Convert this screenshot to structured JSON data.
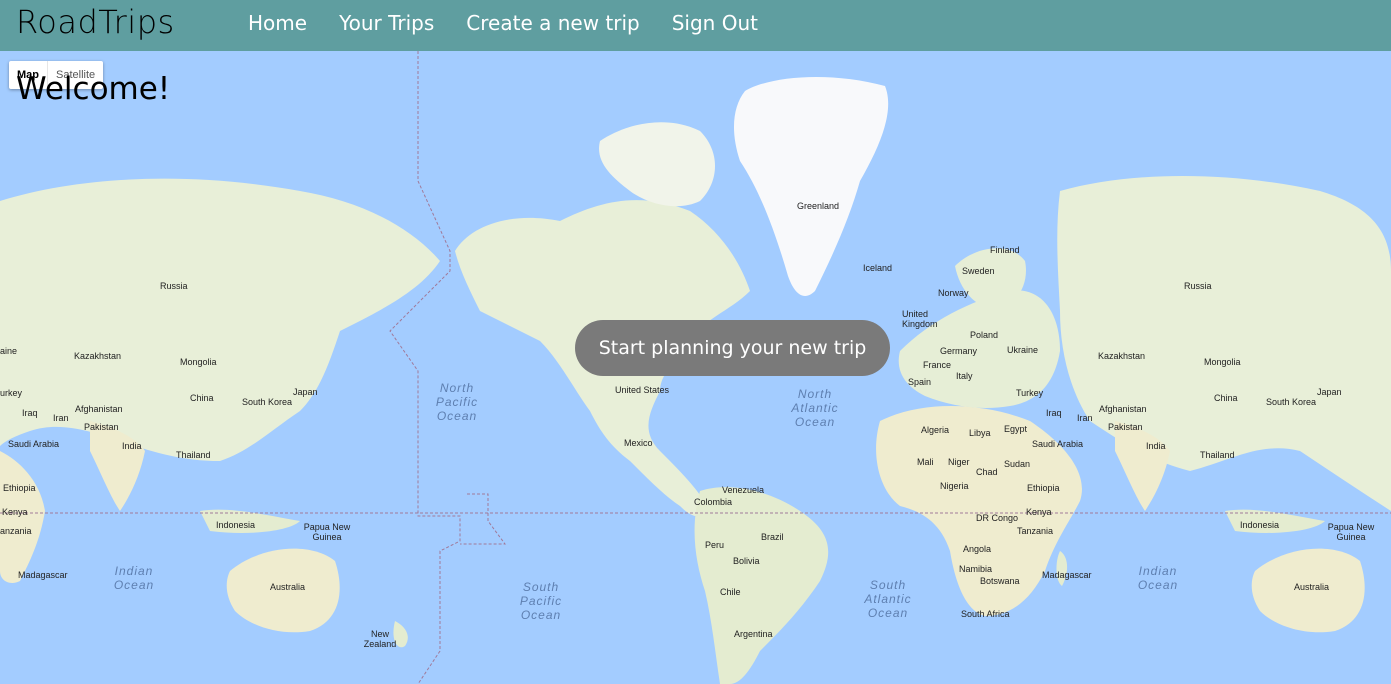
{
  "header": {
    "brand": "RoadTrips",
    "nav": [
      "Home",
      "Your Trips",
      "Create a new trip",
      "Sign Out"
    ]
  },
  "map_controls": {
    "map": "Map",
    "satellite": "Satellite",
    "selected": "Map"
  },
  "welcome": "Welcome!",
  "cta": "Start planning your new trip",
  "map_labels": {
    "greenland": "Greenland",
    "iceland": "Iceland",
    "finland": "Finland",
    "sweden": "Sweden",
    "norway": "Norway",
    "uk": "United Kingdom",
    "poland": "Poland",
    "germany": "Germany",
    "ukraine": "Ukraine",
    "france": "France",
    "italy": "Italy",
    "spain": "Spain",
    "turkey": "Turkey",
    "russia_left": "Russia",
    "russia_right": "Russia",
    "kazakhstan_left": "Kazakhstan",
    "kazakhstan_right": "Kazakhstan",
    "mongolia_left": "Mongolia",
    "mongolia_right": "Mongolia",
    "china_left": "China",
    "china_right": "China",
    "japan_left": "Japan",
    "japan_right": "Japan",
    "south_korea_left": "South Korea",
    "south_korea_right": "South Korea",
    "afghanistan_left": "Afghanistan",
    "afghanistan_right": "Afghanistan",
    "pakistan_left": "Pakistan",
    "pakistan_right": "Pakistan",
    "india_left": "India",
    "india_right": "India",
    "thailand_left": "Thailand",
    "thailand_right": "Thailand",
    "iraq_left": "Iraq",
    "iraq_right": "Iraq",
    "iran_left": "Iran",
    "iran_right": "Iran",
    "saudi_left": "Saudi Arabia",
    "saudi_right": "Saudi Arabia",
    "turkey_left": "urkey",
    "ethiopia_left": "Ethiopia",
    "kenya_left": "Kenya",
    "tanzania_left": "anzania",
    "madagascar_left": "Madagascar",
    "madagascar_right": "Madagascar",
    "indonesia_left": "Indonesia",
    "indonesia_right": "Indonesia",
    "png_left": "Papua New Guinea",
    "png_right": "Papua New Guinea",
    "australia_left": "Australia",
    "australia_right": "Australia",
    "nz": "New Zealand",
    "ukraine_left": "aine",
    "us": "United States",
    "mexico": "Mexico",
    "venezuela": "Venezuela",
    "colombia": "Colombia",
    "peru": "Peru",
    "brazil": "Brazil",
    "bolivia": "Bolivia",
    "chile": "Chile",
    "argentina": "Argentina",
    "algeria": "Algeria",
    "libya": "Libya",
    "egypt": "Egypt",
    "mali": "Mali",
    "niger": "Niger",
    "chad": "Chad",
    "sudan": "Sudan",
    "nigeria": "Nigeria",
    "ethiopia": "Ethiopia",
    "kenya": "Kenya",
    "dr_congo": "DR Congo",
    "tanzania": "Tanzania",
    "angola": "Angola",
    "namibia": "Namibia",
    "botswana": "Botswana",
    "south_africa": "South Africa"
  },
  "oceans": {
    "north_pacific": "North Pacific Ocean",
    "south_pacific": "South Pacific Ocean",
    "north_atlantic": "North Atlantic Ocean",
    "south_atlantic": "South Atlantic Ocean",
    "indian_left": "Indian Ocean",
    "indian_right": "Indian Ocean"
  },
  "colors": {
    "navbar": "#5f9ea0",
    "water": "#a3ccff",
    "land": "#e8efd8",
    "ice": "#f8f9fb",
    "cta": "#7a7a7a"
  }
}
